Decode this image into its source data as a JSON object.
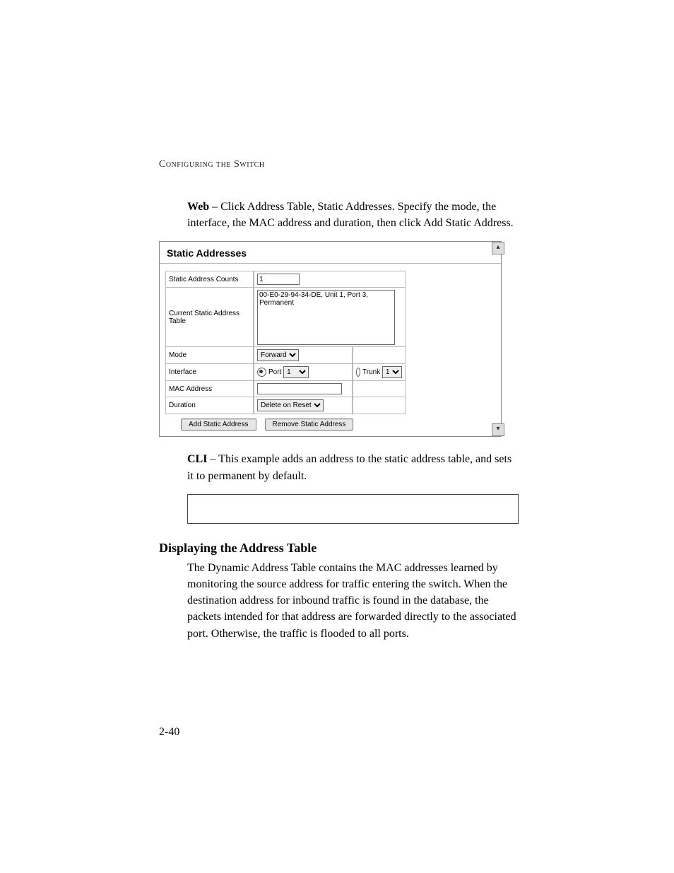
{
  "header": {
    "running_head": "Configuring the Switch"
  },
  "web_para": {
    "lead": "Web",
    "text": " – Click Address Table, Static Addresses. Specify the mode, the interface, the MAC address and duration, then click Add Static Address."
  },
  "panel": {
    "title": "Static Addresses",
    "rows": {
      "counts_label": "Static Address Counts",
      "counts_value": "1",
      "table_label": "Current Static Address Table",
      "table_entry": "00-E0-29-94-34-DE, Unit 1, Port 3, Permanent",
      "mode_label": "Mode",
      "mode_value": "Forward",
      "interface_label": "Interface",
      "port_radio_label": "Port",
      "port_value": "1",
      "trunk_radio_label": "Trunk",
      "trunk_value": "1",
      "mac_label": "MAC Address",
      "mac_value": "",
      "duration_label": "Duration",
      "duration_value": "Delete on Reset"
    },
    "buttons": {
      "add": "Add Static Address",
      "remove": "Remove Static Address"
    },
    "scroll_up": "▴",
    "scroll_down": "▾"
  },
  "cli_para": {
    "lead": "CLI",
    "text": " – This example adds an address to the static address table, and sets it to permanent by default."
  },
  "section": {
    "heading": "Displaying the Address Table",
    "body": "The Dynamic Address Table contains the MAC addresses learned by monitoring the source address for traffic entering the switch. When the destination address for inbound traffic is found in the database, the packets intended for that address are forwarded directly to the associated port. Otherwise, the traffic is flooded to all ports."
  },
  "page_number": "2-40"
}
